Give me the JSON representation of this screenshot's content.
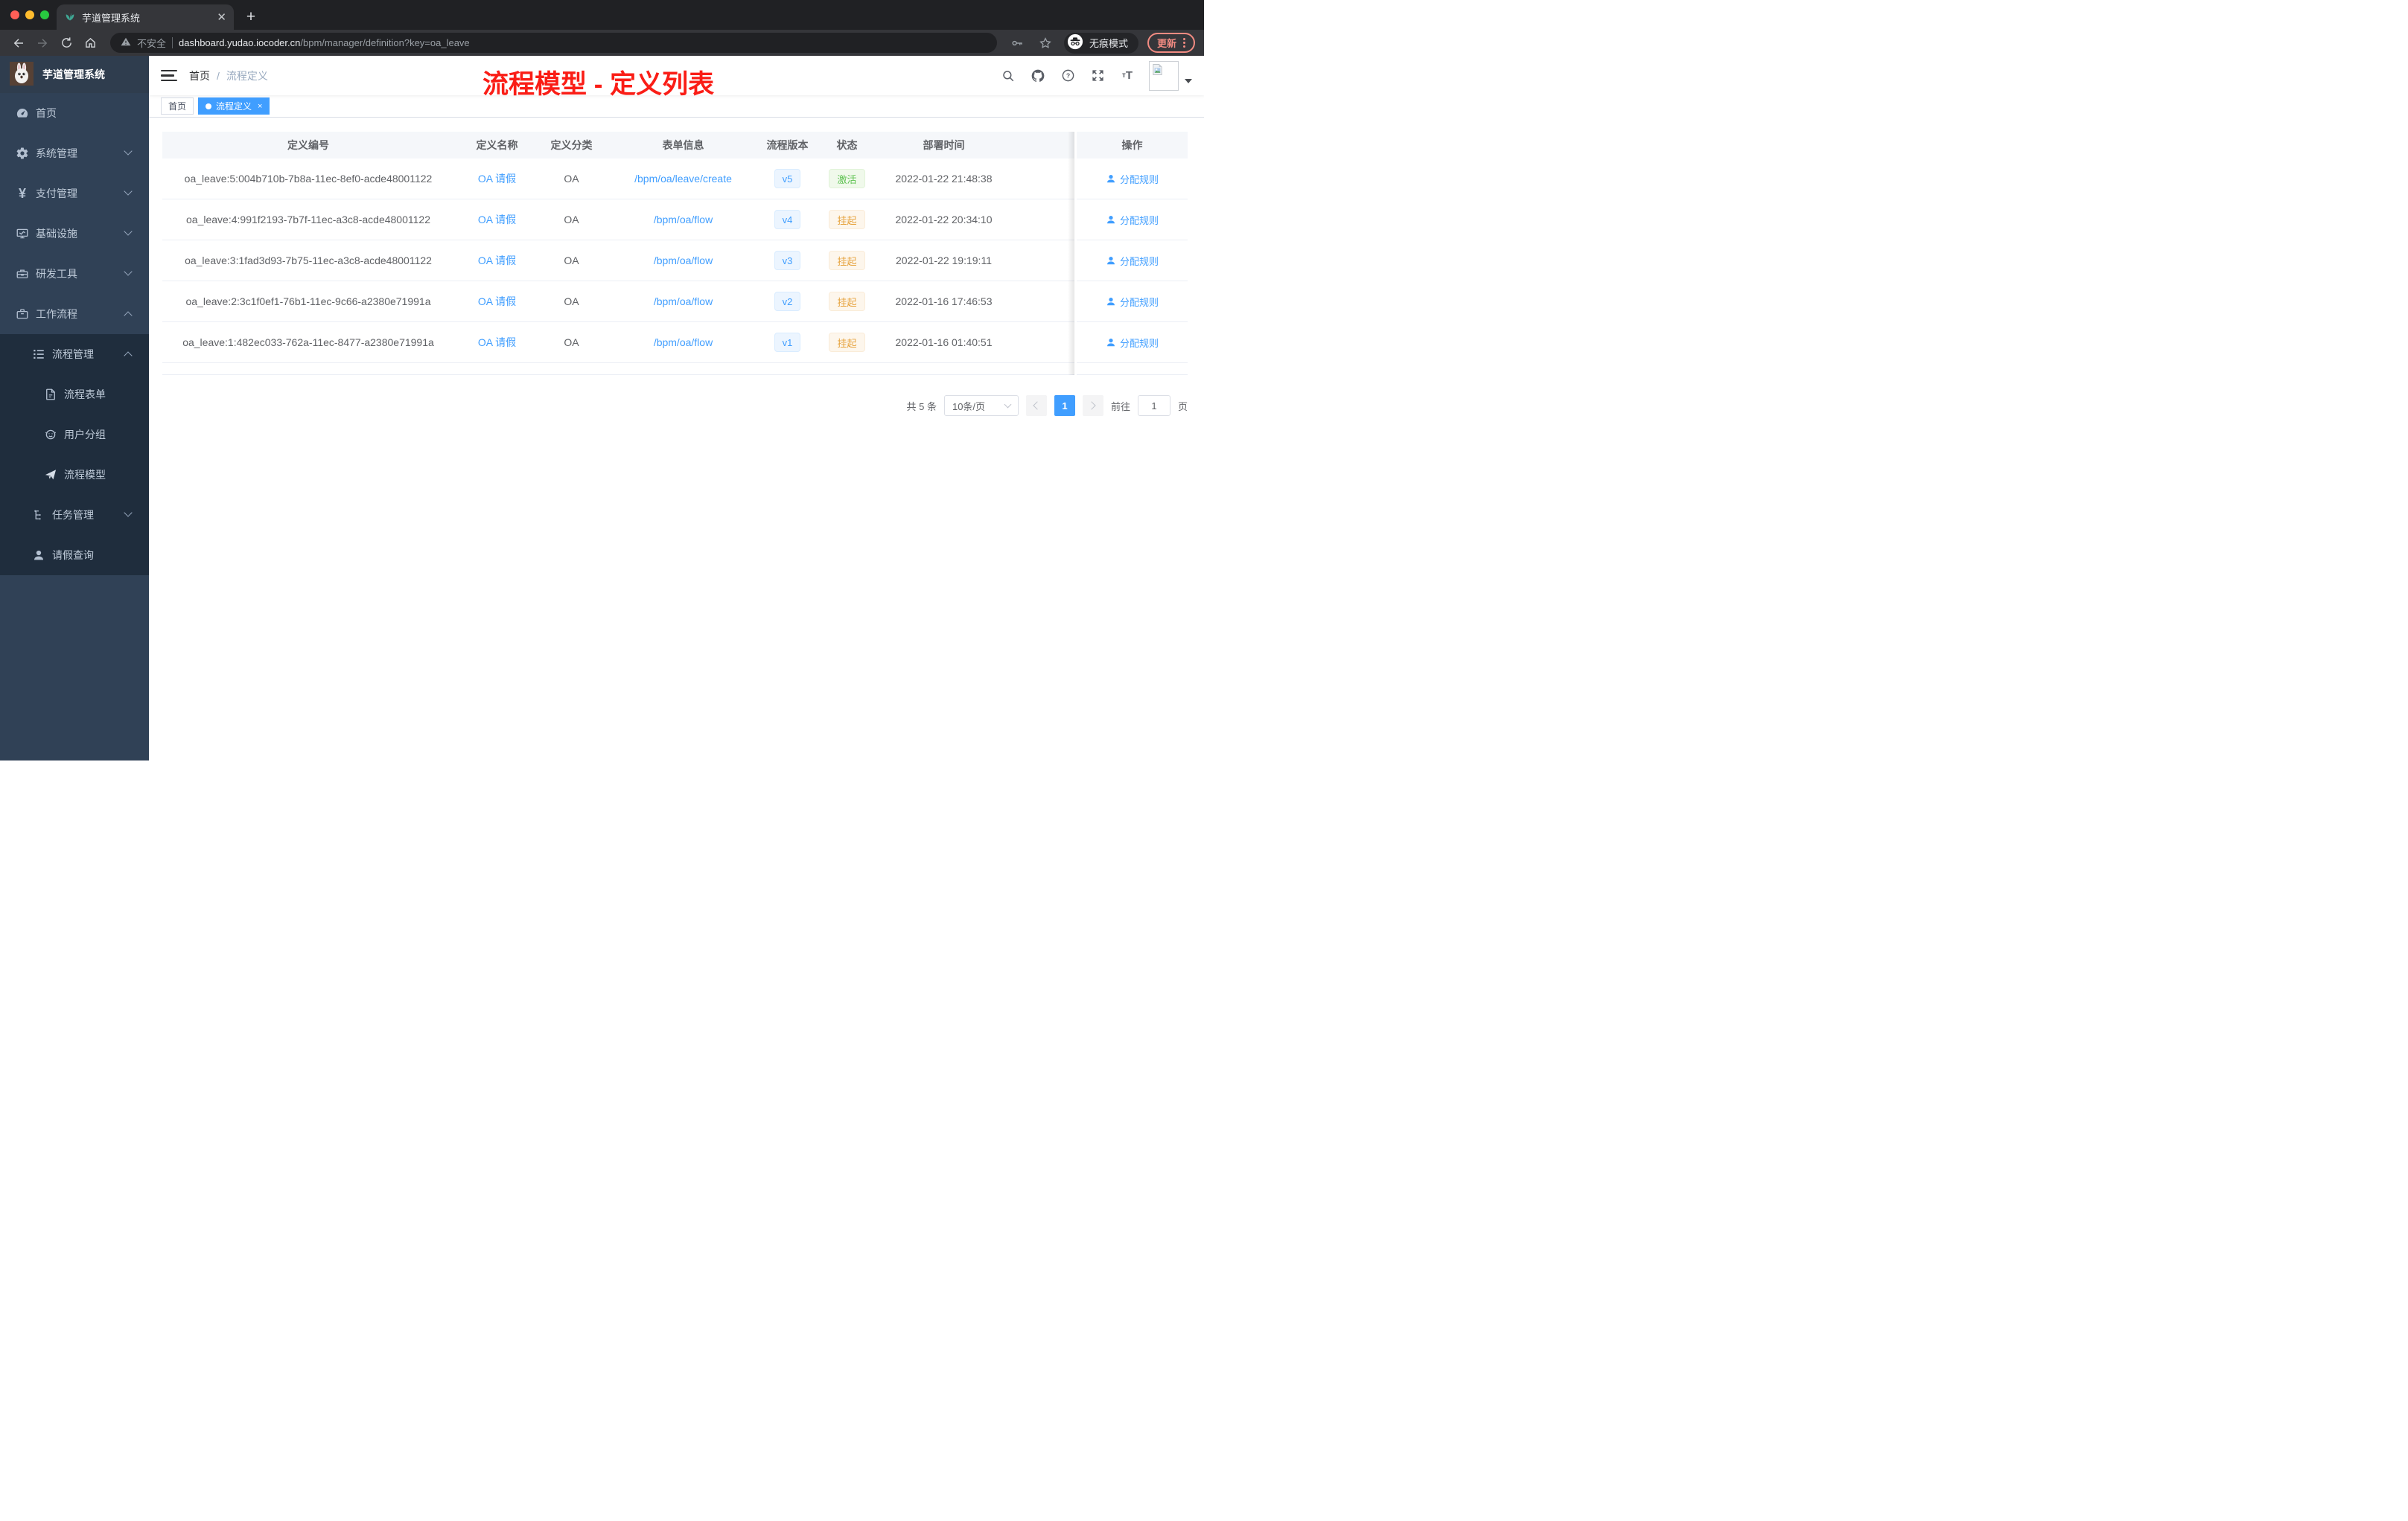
{
  "colors": {
    "accent": "#409eff",
    "success": "#67c23a",
    "warning": "#e6a23c",
    "sidebar_bg": "#304156",
    "submenu_bg": "#1f2d3d",
    "annotation_red": "#fa1d16",
    "update_red": "#f28b82",
    "chrome_dark": "#202124",
    "chrome_toolbar": "#35363a"
  },
  "browser": {
    "tab_title": "芋道管理系统",
    "close_glyph": "✕",
    "newtab_glyph": "+",
    "security_label": "不安全",
    "url_host": "dashboard.yudao.iocoder.cn",
    "url_path": "/bpm/manager/definition?key=oa_leave",
    "incognito_label": "无痕模式",
    "update_label": "更新"
  },
  "sidebar": {
    "logo_title": "芋道管理系统",
    "items": [
      {
        "label": "首页",
        "icon": "dashboard-icon",
        "level": 1
      },
      {
        "label": "系统管理",
        "icon": "gear-icon",
        "level": 1,
        "chevron": "down"
      },
      {
        "label": "支付管理",
        "icon": "yen-icon",
        "level": 1,
        "chevron": "down"
      },
      {
        "label": "基础设施",
        "icon": "monitor-icon",
        "level": 1,
        "chevron": "down"
      },
      {
        "label": "研发工具",
        "icon": "toolbox-icon",
        "level": 1,
        "chevron": "down"
      },
      {
        "label": "工作流程",
        "icon": "briefcase-icon",
        "level": 1,
        "chevron": "up"
      },
      {
        "label": "流程管理",
        "icon": "list-icon",
        "level": 2,
        "chevron": "up"
      },
      {
        "label": "流程表单",
        "icon": "form-icon",
        "level": 3
      },
      {
        "label": "用户分组",
        "icon": "group-icon",
        "level": 3
      },
      {
        "label": "流程模型",
        "icon": "send-icon",
        "level": 3
      },
      {
        "label": "任务管理",
        "icon": "tree-icon",
        "level": 2,
        "chevron": "down"
      },
      {
        "label": "请假查询",
        "icon": "user-icon",
        "level": 2
      }
    ]
  },
  "header": {
    "breadcrumb_home": "首页",
    "breadcrumb_sep": "/",
    "breadcrumb_current": "流程定义",
    "annotation": "流程模型 - 定义列表"
  },
  "tags": {
    "home": "首页",
    "current": "流程定义",
    "close_glyph": "×"
  },
  "table": {
    "columns": [
      "定义编号",
      "定义名称",
      "定义分类",
      "表单信息",
      "流程版本",
      "状态",
      "部署时间",
      "操作"
    ],
    "action_label": "分配规则",
    "rows": [
      {
        "id": "oa_leave:5:004b710b-7b8a-11ec-8ef0-acde48001122",
        "name": "OA 请假",
        "category": "OA",
        "form": "/bpm/oa/leave/create",
        "version": "v5",
        "status": "激活",
        "status_type": "success",
        "deployed": "2022-01-22 21:48:38",
        "action": "分配规则"
      },
      {
        "id": "oa_leave:4:991f2193-7b7f-11ec-a3c8-acde48001122",
        "name": "OA 请假",
        "category": "OA",
        "form": "/bpm/oa/flow",
        "version": "v4",
        "status": "挂起",
        "status_type": "warning",
        "deployed": "2022-01-22 20:34:10",
        "action": "分配规则"
      },
      {
        "id": "oa_leave:3:1fad3d93-7b75-11ec-a3c8-acde48001122",
        "name": "OA 请假",
        "category": "OA",
        "form": "/bpm/oa/flow",
        "version": "v3",
        "status": "挂起",
        "status_type": "warning",
        "deployed": "2022-01-22 19:19:11",
        "action": "分配规则"
      },
      {
        "id": "oa_leave:2:3c1f0ef1-76b1-11ec-9c66-a2380e71991a",
        "name": "OA 请假",
        "category": "OA",
        "form": "/bpm/oa/flow",
        "version": "v2",
        "status": "挂起",
        "status_type": "warning",
        "deployed": "2022-01-16 17:46:53",
        "action": "分配规则"
      },
      {
        "id": "oa_leave:1:482ec033-762a-11ec-8477-a2380e71991a",
        "name": "OA 请假",
        "category": "OA",
        "form": "/bpm/oa/flow",
        "version": "v1",
        "status": "挂起",
        "status_type": "warning",
        "deployed": "2022-01-16 01:40:51",
        "action": "分配规则"
      }
    ]
  },
  "pagination": {
    "total": "共 5 条",
    "page_size": "10条/页",
    "current_page": "1",
    "goto_label": "前往",
    "goto_value": "1",
    "page_unit": "页"
  }
}
